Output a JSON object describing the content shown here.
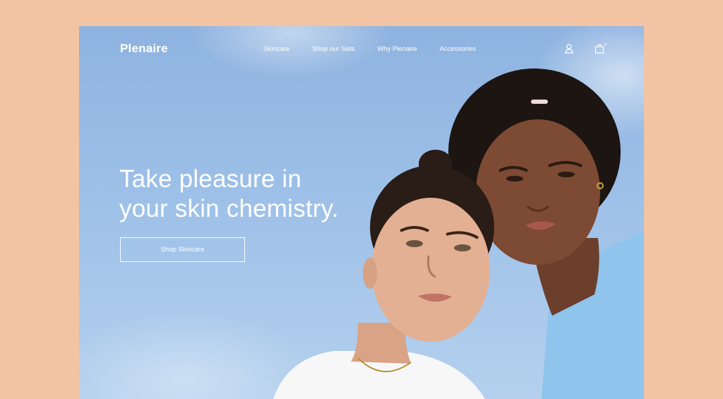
{
  "brand": {
    "logo_text": "Plenaire"
  },
  "nav": {
    "items": [
      {
        "label": "Skincare"
      },
      {
        "label": "Shop our Sets"
      },
      {
        "label": "Why Plenaire"
      },
      {
        "label": "Accessories"
      }
    ],
    "cart_count": "0"
  },
  "hero": {
    "title_line1": "Take pleasure in",
    "title_line2": "your skin chemistry.",
    "cta_label": "Shop Skincare"
  },
  "icons": [
    "user-icon",
    "shopping-bag-icon"
  ],
  "colors": {
    "page_background": "#f2c4a3",
    "sky": "#9dc0e8",
    "text": "#ffffff",
    "shirt": "#8fc4ec"
  }
}
